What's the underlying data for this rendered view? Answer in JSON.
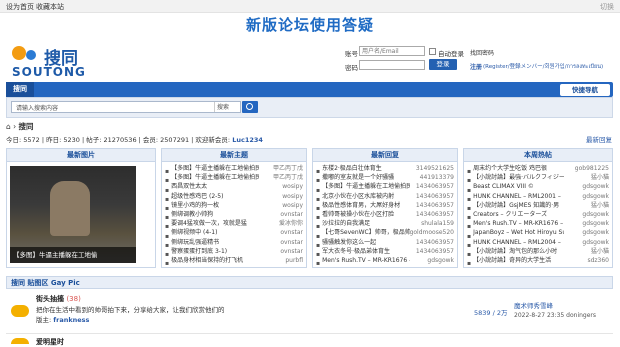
{
  "topbar": {
    "set_home": "设为首页",
    "bookmark": "收藏本站",
    "right_text": "切换"
  },
  "banner": {
    "title": "新版论坛使用答疑"
  },
  "logo": {
    "cn": "搜同",
    "en": "SOUTONG"
  },
  "login": {
    "account_label": "账号",
    "account_placeholder": "用户名/Email",
    "auto_login": "自动登录",
    "find_password": "找回密码",
    "password_label": "密码",
    "login_button": "登录",
    "register_label": "注册",
    "register_text": "(Register/登録メンバー/회원가입/การลงทะเบียน)"
  },
  "nav": {
    "item": "搜同",
    "quick_nav": "快捷导航"
  },
  "search": {
    "placeholder": "请输入搜索内容",
    "type": "搜索"
  },
  "breadcrumb": {
    "home": "⌂",
    "sep": "›",
    "current": "搜同"
  },
  "stats": {
    "text": "今日: 5572 | 昨日: 5230 | 帖子: 21270536 | 会员: 2507291 | 欢迎新会员:",
    "new_member": "Luc1234"
  },
  "latest_link": "最新回复",
  "boxes": {
    "images": {
      "title": "最新图片",
      "caption": "【多图】牛逼主播躲在工地偷"
    },
    "topics": {
      "title": "最新主题",
      "items": [
        {
          "t": "【多图】牛逼主播躲在工地偷拍民",
          "a": "甲乙丙丁戊"
        },
        {
          "t": "【多图】牛逼主播躲在工地偷拍民",
          "a": "甲乙丙丁戊"
        },
        {
          "t": "西昌双性太太",
          "a": "wosipy"
        },
        {
          "t": "超级性感鸡巴 (2-5)",
          "a": "wosipy"
        },
        {
          "t": "镜里小鸡的狗一枚",
          "a": "wosipy"
        },
        {
          "t": "侧绑调教小帅狗",
          "a": "ovnstar"
        },
        {
          "t": "要调4猛攻做一次，攻就是猛",
          "a": "爱冰你你"
        },
        {
          "t": "侧绑视频中 (4-1)",
          "a": "ovnstar"
        },
        {
          "t": "侧绑玩乱强逼精书",
          "a": "ovnstar"
        },
        {
          "t": "警察蛋蛋打到底 3-1)",
          "a": "ovnstar"
        },
        {
          "t": "极品身材相当保持的打飞机",
          "a": "purbfl"
        }
      ]
    },
    "replies": {
      "title": "最新回复",
      "items": [
        {
          "t": "东楼2·极品白壮体育生",
          "a": "3149521625"
        },
        {
          "t": "撒嘟的室友就是一个好骚骚",
          "a": "441913379"
        },
        {
          "t": "【多图】牛逼主播躲在工地偷拍民",
          "a": "1434063957"
        },
        {
          "t": "北京小伙在小区水库被内射",
          "a": "1434063957"
        },
        {
          "t": "极品性感体育男，大屌好身材",
          "a": "1434063957"
        },
        {
          "t": "看帅哥被操小伙在小区打脸",
          "a": "1434063957"
        },
        {
          "t": "沙拉拉的自我满足",
          "a": "shulala159"
        },
        {
          "t": "【七哥SevenWC】帅哥，极品帅鸡鸡",
          "a": "goldmoose520"
        },
        {
          "t": "骚骚触发你这么一起",
          "a": "1434063957"
        },
        {
          "t": "军大衣冬号·极品弟体育生",
          "a": "1434063957"
        },
        {
          "t": "Men's Rush.TV – MR-KR1676 –",
          "a": "gdsgowk"
        }
      ]
    },
    "hot": {
      "title": "本周热帖",
      "items": [
        {
          "t": "周末约个大学生吃饭 鸡巴很",
          "a": "gob981225"
        },
        {
          "t": "【小說討論】最強·バルクフィジー",
          "a": "猛小貓"
        },
        {
          "t": "Beast CLIMAX VIII ©",
          "a": "gdsgowk"
        },
        {
          "t": "HUNK CHANNEL – RML2001 –",
          "a": "gdsgowk"
        },
        {
          "t": "【小說討論】GsjMES 知識的·男",
          "a": "猛小貓"
        },
        {
          "t": "Creators – クリエーターズ",
          "a": "gdsgowk"
        },
        {
          "t": "Men's Rush.TV – MR-KR1676 –",
          "a": "gdsgowk"
        },
        {
          "t": "JapanBoyz – Wet Hot Hiroyu Su",
          "a": "gdsgowk"
        },
        {
          "t": "HUNK CHANNEL – RML2004 –",
          "a": "gdsgowk"
        },
        {
          "t": "【小說討論】淘气包的那么小时",
          "a": "猛小貓"
        },
        {
          "t": "【小說討論】奇异的大学生活",
          "a": "sdz360"
        }
      ]
    }
  },
  "section": {
    "title": "搜同 贴图区 Gay Pic"
  },
  "forum": {
    "name": "街头抽搐",
    "count": "(38)",
    "desc": "把你在生活中看到的帅哥拍下来，分享给大家，让我们欣赏他们的",
    "mod_label": "版主:",
    "mod": "frankness",
    "num": "5839 / 2万",
    "last_title": "魔术师秀雪峰",
    "last_meta": "2022-8-27 23:35 doningers"
  },
  "forum2": {
    "name": "爱明星时"
  }
}
